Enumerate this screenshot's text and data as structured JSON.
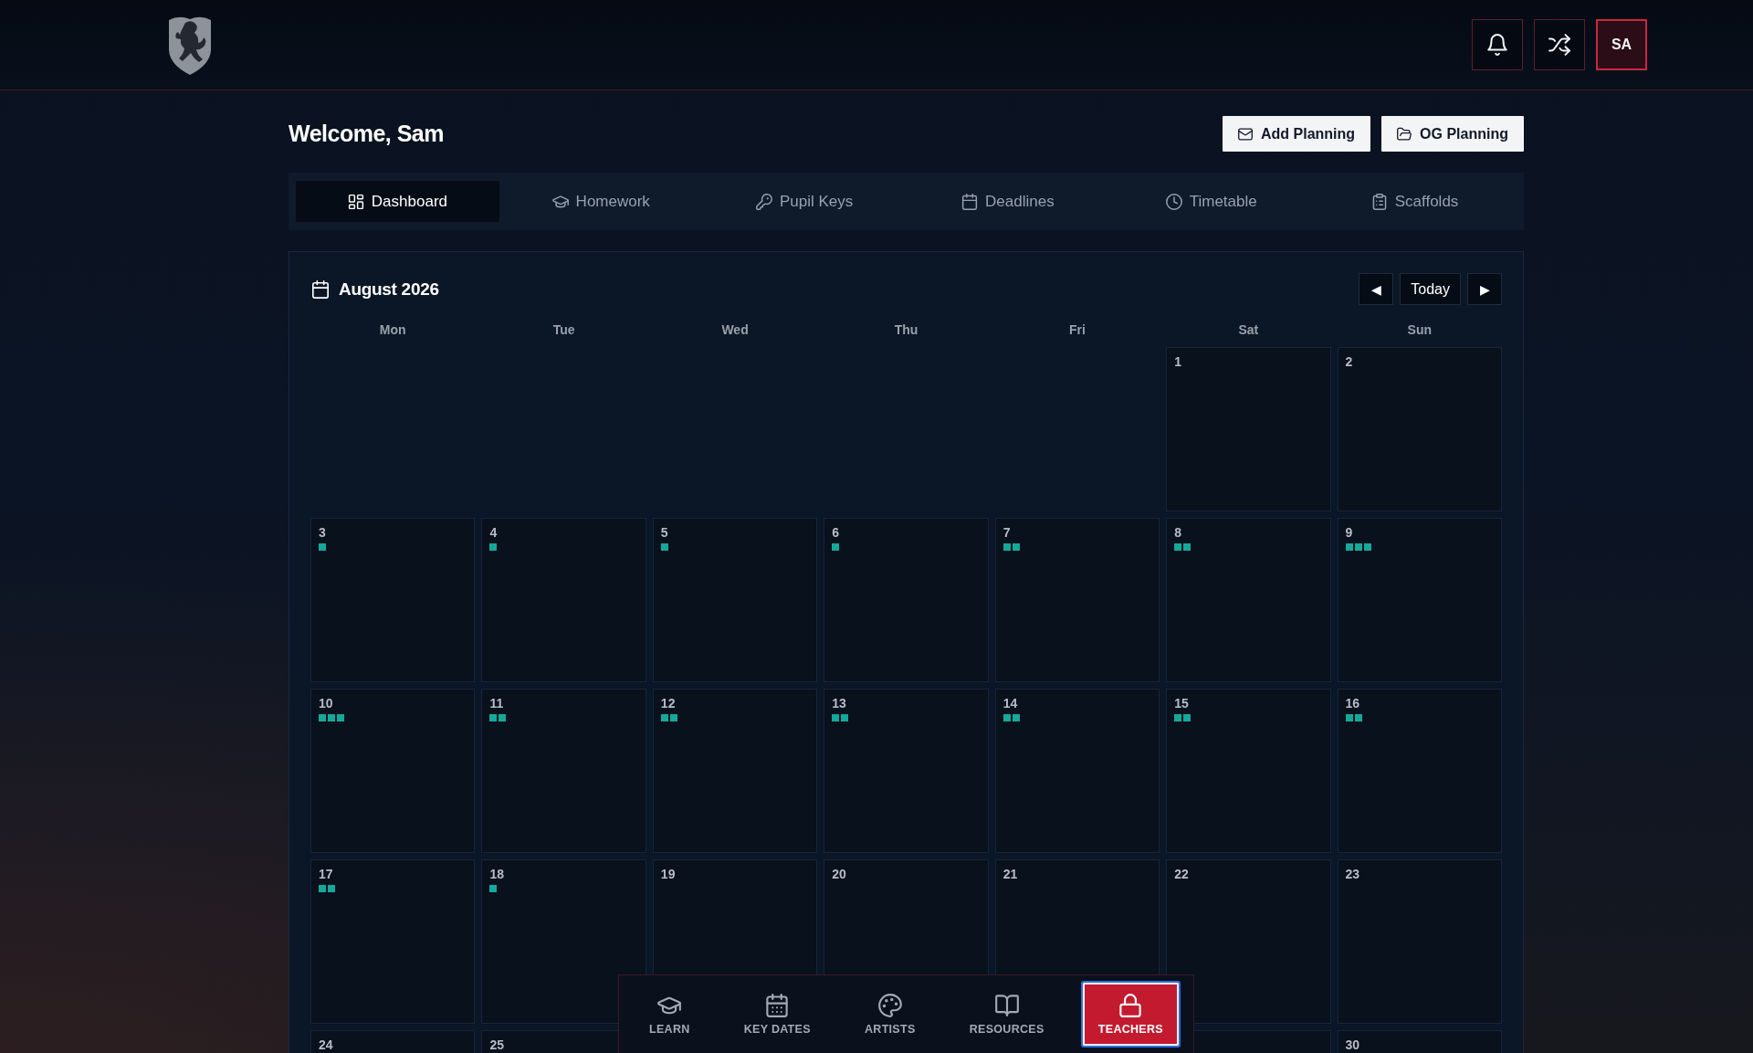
{
  "header": {
    "avatar": "SA"
  },
  "welcome": {
    "title": "Welcome, Sam",
    "actions": [
      {
        "label": "Add Planning"
      },
      {
        "label": "OG Planning"
      }
    ]
  },
  "tabs": [
    {
      "label": "Dashboard",
      "selected": true
    },
    {
      "label": "Homework",
      "selected": false
    },
    {
      "label": "Pupil Keys",
      "selected": false
    },
    {
      "label": "Deadlines",
      "selected": false
    },
    {
      "label": "Timetable",
      "selected": false
    },
    {
      "label": "Scaffolds",
      "selected": false
    }
  ],
  "calendar": {
    "title": "August 2026",
    "nav": {
      "previous": "◀",
      "today": "Today",
      "next": "▶"
    },
    "weekdays": [
      "Mon",
      "Tue",
      "Wed",
      "Thu",
      "Fri",
      "Sat",
      "Sun"
    ],
    "weeks": [
      {
        "days": [
          {
            "kind": "empty"
          },
          {
            "kind": "empty"
          },
          {
            "kind": "empty"
          },
          {
            "kind": "empty"
          },
          {
            "kind": "empty"
          },
          {
            "kind": "date",
            "label": "1"
          },
          {
            "kind": "date",
            "label": "2"
          }
        ]
      },
      {
        "days": [
          {
            "kind": "date",
            "label": "3",
            "events": [
              {
                "color": "#14a99b"
              }
            ]
          },
          {
            "kind": "date",
            "label": "4",
            "events": [
              {
                "color": "#14a99b"
              }
            ]
          },
          {
            "kind": "date",
            "label": "5",
            "events": [
              {
                "color": "#14a99b"
              }
            ]
          },
          {
            "kind": "date",
            "label": "6",
            "events": [
              {
                "color": "#14a99b"
              }
            ]
          },
          {
            "kind": "date",
            "label": "7",
            "events": [
              {
                "color": "#14a99b"
              },
              {
                "color": "#14a99b"
              }
            ]
          },
          {
            "kind": "date",
            "label": "8",
            "events": [
              {
                "color": "#14a99b"
              },
              {
                "color": "#14a99b"
              }
            ]
          },
          {
            "kind": "date",
            "label": "9",
            "events": [
              {
                "color": "#14a99b"
              },
              {
                "color": "#14a99b"
              },
              {
                "color": "#14a99b"
              }
            ]
          }
        ]
      },
      {
        "days": [
          {
            "kind": "date",
            "label": "10",
            "events": [
              {
                "color": "#14a99b"
              },
              {
                "color": "#14a99b"
              },
              {
                "color": "#14a99b"
              }
            ]
          },
          {
            "kind": "date",
            "label": "11",
            "events": [
              {
                "color": "#14a99b"
              },
              {
                "color": "#14a99b"
              }
            ]
          },
          {
            "kind": "date",
            "label": "12",
            "events": [
              {
                "color": "#14a99b"
              },
              {
                "color": "#14a99b"
              }
            ]
          },
          {
            "kind": "date",
            "label": "13",
            "events": [
              {
                "color": "#14a99b"
              },
              {
                "color": "#14a99b"
              }
            ]
          },
          {
            "kind": "date",
            "label": "14",
            "events": [
              {
                "color": "#14a99b"
              },
              {
                "color": "#14a99b"
              }
            ]
          },
          {
            "kind": "date",
            "label": "15",
            "events": [
              {
                "color": "#14a99b"
              },
              {
                "color": "#14a99b"
              }
            ]
          },
          {
            "kind": "date",
            "label": "16",
            "events": [
              {
                "color": "#14a99b"
              },
              {
                "color": "#14a99b"
              }
            ]
          }
        ]
      },
      {
        "days": [
          {
            "kind": "date",
            "label": "17",
            "events": [
              {
                "color": "#14a99b"
              },
              {
                "color": "#14a99b"
              }
            ]
          },
          {
            "kind": "date",
            "label": "18",
            "events": [
              {
                "color": "#14a99b"
              }
            ]
          },
          {
            "kind": "date",
            "label": "19"
          },
          {
            "kind": "date",
            "label": "20"
          },
          {
            "kind": "date",
            "label": "21"
          },
          {
            "kind": "date",
            "label": "22"
          },
          {
            "kind": "date",
            "label": "23"
          }
        ]
      },
      {
        "days": [
          {
            "kind": "date",
            "label": "24"
          },
          {
            "kind": "date",
            "label": "25"
          },
          {
            "kind": "empty"
          },
          {
            "kind": "empty"
          },
          {
            "kind": "empty"
          },
          {
            "kind": "date"
          },
          {
            "kind": "date",
            "label": "30"
          }
        ]
      }
    ]
  },
  "bottom_nav": [
    {
      "label": "LEARN",
      "selected": false
    },
    {
      "label": "KEY DATES",
      "selected": false
    },
    {
      "label": "ARTISTS",
      "selected": false
    },
    {
      "label": "RESOURCES",
      "selected": false
    },
    {
      "label": "TEACHERS",
      "selected": true
    }
  ]
}
